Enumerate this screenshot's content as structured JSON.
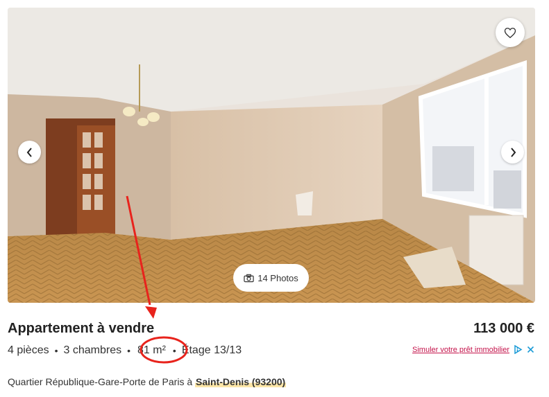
{
  "listing": {
    "photos_label": "14 Photos",
    "title": "Appartement à vendre",
    "price": "113 000 €",
    "features": {
      "rooms": "4 pièces",
      "bedrooms": "3 chambres",
      "surface": "81 m²",
      "floor": "Étage 13/13",
      "separator": "•"
    },
    "loan_link": "Simuler votre prêt immobilier",
    "address_prefix": "Quartier République-Gare-Porte de Paris à ",
    "city": "Saint-Denis (93200)"
  },
  "icons": {
    "favorite": "heart-icon",
    "prev": "chevron-left-icon",
    "next": "chevron-right-icon",
    "photos": "camera-icon",
    "ad_choices": "adchoices-icon",
    "ad_close": "close-icon"
  },
  "colors": {
    "annotation_red": "#e8231c",
    "loan_link": "#c4124a",
    "city_highlight": "#fbe5a7",
    "adchoices_blue": "#1a9bd7"
  }
}
